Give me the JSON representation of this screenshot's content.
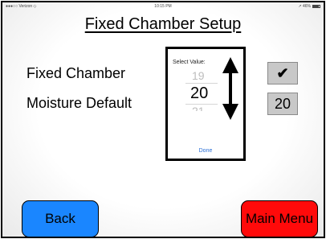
{
  "status_bar": {
    "left": "●●●○○ Verizon ◇",
    "time": "10:15 PM",
    "right": "↗ 46% "
  },
  "header": {
    "title": "Fixed Chamber Setup"
  },
  "settings": {
    "fixed_chamber_label": "Fixed Chamber",
    "fixed_chamber_value": "✔",
    "moisture_default_label": "Moisture Default",
    "moisture_default_value": "20"
  },
  "picker": {
    "title": "Select Value:",
    "previous": "19",
    "current": "20",
    "next": "21",
    "done_label": "Done"
  },
  "footer": {
    "back_label": "Back",
    "main_menu_label": "Main Menu"
  },
  "colors": {
    "back_button": "#1a86ff",
    "main_menu_button": "#ff0a0a",
    "value_box": "#c8c8c8",
    "done_link": "#2a6fd6"
  }
}
